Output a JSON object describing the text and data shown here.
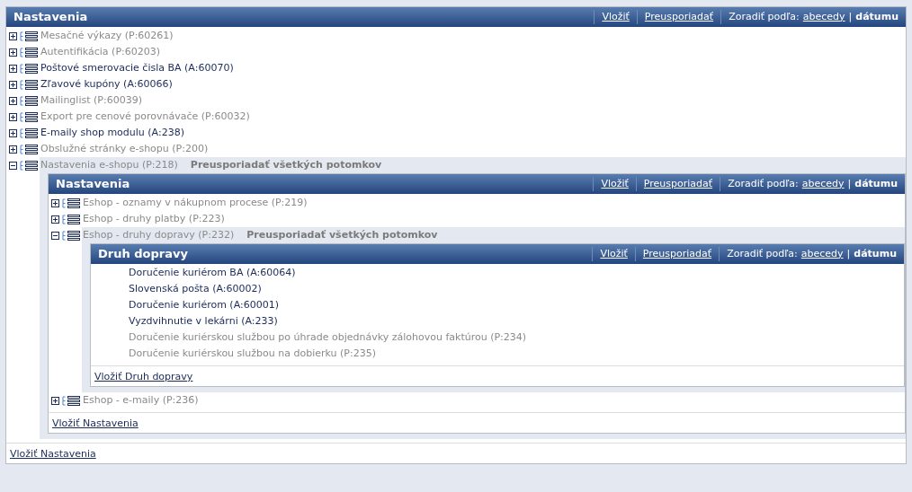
{
  "panel": {
    "title": "Nastavenia",
    "insert": "Vložiť",
    "reorder": "Preusporiadať",
    "sort_label": "Zoradiť podľa:",
    "sort_separator": "|",
    "sort_options": [
      {
        "label": "abecedy",
        "selected": false
      },
      {
        "label": "dátumu",
        "selected": true
      }
    ],
    "items": [
      {
        "kind": "node",
        "label": "Mesačné výkazy (P:60261)",
        "inactive": true,
        "expanded": false
      },
      {
        "kind": "node",
        "label": "Autentifikácia (P:60203)",
        "inactive": true,
        "expanded": false
      },
      {
        "kind": "node",
        "label": "Poštové smerovacie čisla BA (A:60070)",
        "inactive": false,
        "expanded": false
      },
      {
        "kind": "node",
        "label": "Zľavové kupóny (A:60066)",
        "inactive": false,
        "expanded": false
      },
      {
        "kind": "node",
        "label": "Mailinglist (P:60039)",
        "inactive": true,
        "expanded": false
      },
      {
        "kind": "node",
        "label": "Export pre cenové porovnávače (P:60032)",
        "inactive": true,
        "expanded": false
      },
      {
        "kind": "node",
        "label": "E-maily shop modulu (A:238)",
        "inactive": false,
        "expanded": false
      },
      {
        "kind": "node",
        "label": "Obslužné stránky e-shopu (P:200)",
        "inactive": true,
        "expanded": false
      },
      {
        "kind": "node",
        "label": "Nastavenia e-shopu (P:218)",
        "inactive": true,
        "expanded": true,
        "reorder_children": "Preusporiadať všetkých potomkov",
        "panel": {
          "title": "Nastavenia",
          "insert": "Vložiť",
          "reorder": "Preusporiadať",
          "sort_label": "Zoradiť podľa:",
          "sort_separator": "|",
          "sort_options": [
            {
              "label": "abecedy",
              "selected": false
            },
            {
              "label": "dátumu",
              "selected": true
            }
          ],
          "items": [
            {
              "kind": "node",
              "label": "Eshop - oznamy v nákupnom procese (P:219)",
              "inactive": true,
              "expanded": false
            },
            {
              "kind": "node",
              "label": "Eshop - druhy platby (P:223)",
              "inactive": true,
              "expanded": false
            },
            {
              "kind": "node",
              "label": "Eshop - druhy dopravy (P:232)",
              "inactive": true,
              "expanded": true,
              "reorder_children": "Preusporiadať všetkých potomkov",
              "panel": {
                "title": "Druh dopravy",
                "insert": "Vložiť",
                "reorder": "Preusporiadať",
                "sort_label": "Zoradiť podľa:",
                "sort_separator": "|",
                "sort_options": [
                  {
                    "label": "abecedy",
                    "selected": false
                  },
                  {
                    "label": "dátumu",
                    "selected": true
                  }
                ],
                "items": [
                  {
                    "kind": "leaf",
                    "label": "Doručenie kuriérom BA (A:60064)",
                    "inactive": false
                  },
                  {
                    "kind": "leaf",
                    "label": "Slovenská pošta (A:60002)",
                    "inactive": false
                  },
                  {
                    "kind": "leaf",
                    "label": "Doručenie kuriérom (A:60001)",
                    "inactive": false
                  },
                  {
                    "kind": "leaf",
                    "label": "Vyzdvihnutie v lekárni (A:233)",
                    "inactive": false
                  },
                  {
                    "kind": "leaf",
                    "label": "Doručenie kuriérskou službou po úhrade objednávky zálohovou faktúrou (P:234)",
                    "inactive": true
                  },
                  {
                    "kind": "leaf",
                    "label": "Doručenie kuriérskou službou na dobierku (P:235)",
                    "inactive": true
                  }
                ],
                "footer_link": "Vložiť Druh dopravy"
              }
            },
            {
              "kind": "node",
              "label": "Eshop - e-maily (P:236)",
              "inactive": true,
              "expanded": false
            }
          ],
          "footer_link": "Vložiť Nastavenia"
        }
      }
    ],
    "footer_link": "Vložiť Nastavenia"
  }
}
